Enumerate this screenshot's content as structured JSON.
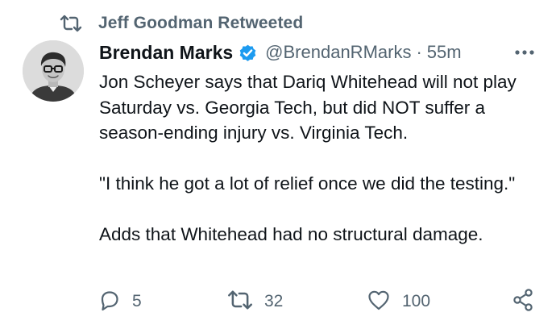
{
  "retweet_context": {
    "label": "Jeff Goodman Retweeted",
    "icon": "retweet-icon"
  },
  "author": {
    "display_name": "Brendan Marks",
    "verified_icon": "verified-badge-icon",
    "handle": "@BrendanRMarks",
    "separator": "·",
    "time": "55m",
    "more_icon": "more-options-icon"
  },
  "tweet": {
    "paragraphs": [
      "Jon Scheyer says that Dariq Whitehead will not play Saturday vs. Georgia Tech, but did NOT suffer a season-ending injury vs. Virginia Tech.",
      "\"I think he got a lot of relief once we did the testing.\"",
      "Adds that Whitehead had no structural damage."
    ]
  },
  "actions": {
    "reply": {
      "icon": "reply-icon",
      "count": "5"
    },
    "retweet": {
      "icon": "retweet-icon",
      "count": "32"
    },
    "like": {
      "icon": "heart-icon",
      "count": "100"
    },
    "share": {
      "icon": "share-icon"
    }
  },
  "colors": {
    "text": "#0f1419",
    "secondary": "#536471",
    "verified": "#1d9bf0",
    "background": "#ffffff"
  }
}
